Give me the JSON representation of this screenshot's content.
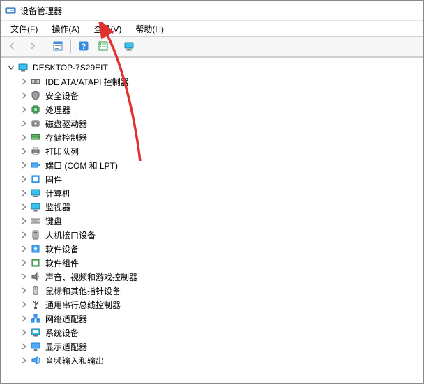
{
  "window": {
    "title": "设备管理器"
  },
  "menu": {
    "file": "文件(F)",
    "action": "操作(A)",
    "view": "查看(V)",
    "help": "帮助(H)"
  },
  "toolbar": {
    "back": "后退",
    "forward": "前进",
    "properties": "属性",
    "help": "帮助",
    "show_hidden": "显示隐藏的设备",
    "monitor": "监视器"
  },
  "tree": {
    "root": {
      "label": "DESKTOP-7S29EIT",
      "expanded": true
    },
    "items": [
      {
        "label": "IDE ATA/ATAPI 控制器",
        "icon": "ide"
      },
      {
        "label": "安全设备",
        "icon": "security"
      },
      {
        "label": "处理器",
        "icon": "cpu"
      },
      {
        "label": "磁盘驱动器",
        "icon": "disk"
      },
      {
        "label": "存储控制器",
        "icon": "storage"
      },
      {
        "label": "打印队列",
        "icon": "printer"
      },
      {
        "label": "端口 (COM 和 LPT)",
        "icon": "port"
      },
      {
        "label": "固件",
        "icon": "firmware"
      },
      {
        "label": "计算机",
        "icon": "computer"
      },
      {
        "label": "监视器",
        "icon": "monitor"
      },
      {
        "label": "键盘",
        "icon": "keyboard"
      },
      {
        "label": "人机接口设备",
        "icon": "hid"
      },
      {
        "label": "软件设备",
        "icon": "software"
      },
      {
        "label": "软件组件",
        "icon": "component"
      },
      {
        "label": "声音、视频和游戏控制器",
        "icon": "sound"
      },
      {
        "label": "鼠标和其他指针设备",
        "icon": "mouse"
      },
      {
        "label": "通用串行总线控制器",
        "icon": "usb"
      },
      {
        "label": "网络适配器",
        "icon": "network"
      },
      {
        "label": "系统设备",
        "icon": "system"
      },
      {
        "label": "显示适配器",
        "icon": "display"
      },
      {
        "label": "音频输入和输出",
        "icon": "audio"
      }
    ]
  }
}
